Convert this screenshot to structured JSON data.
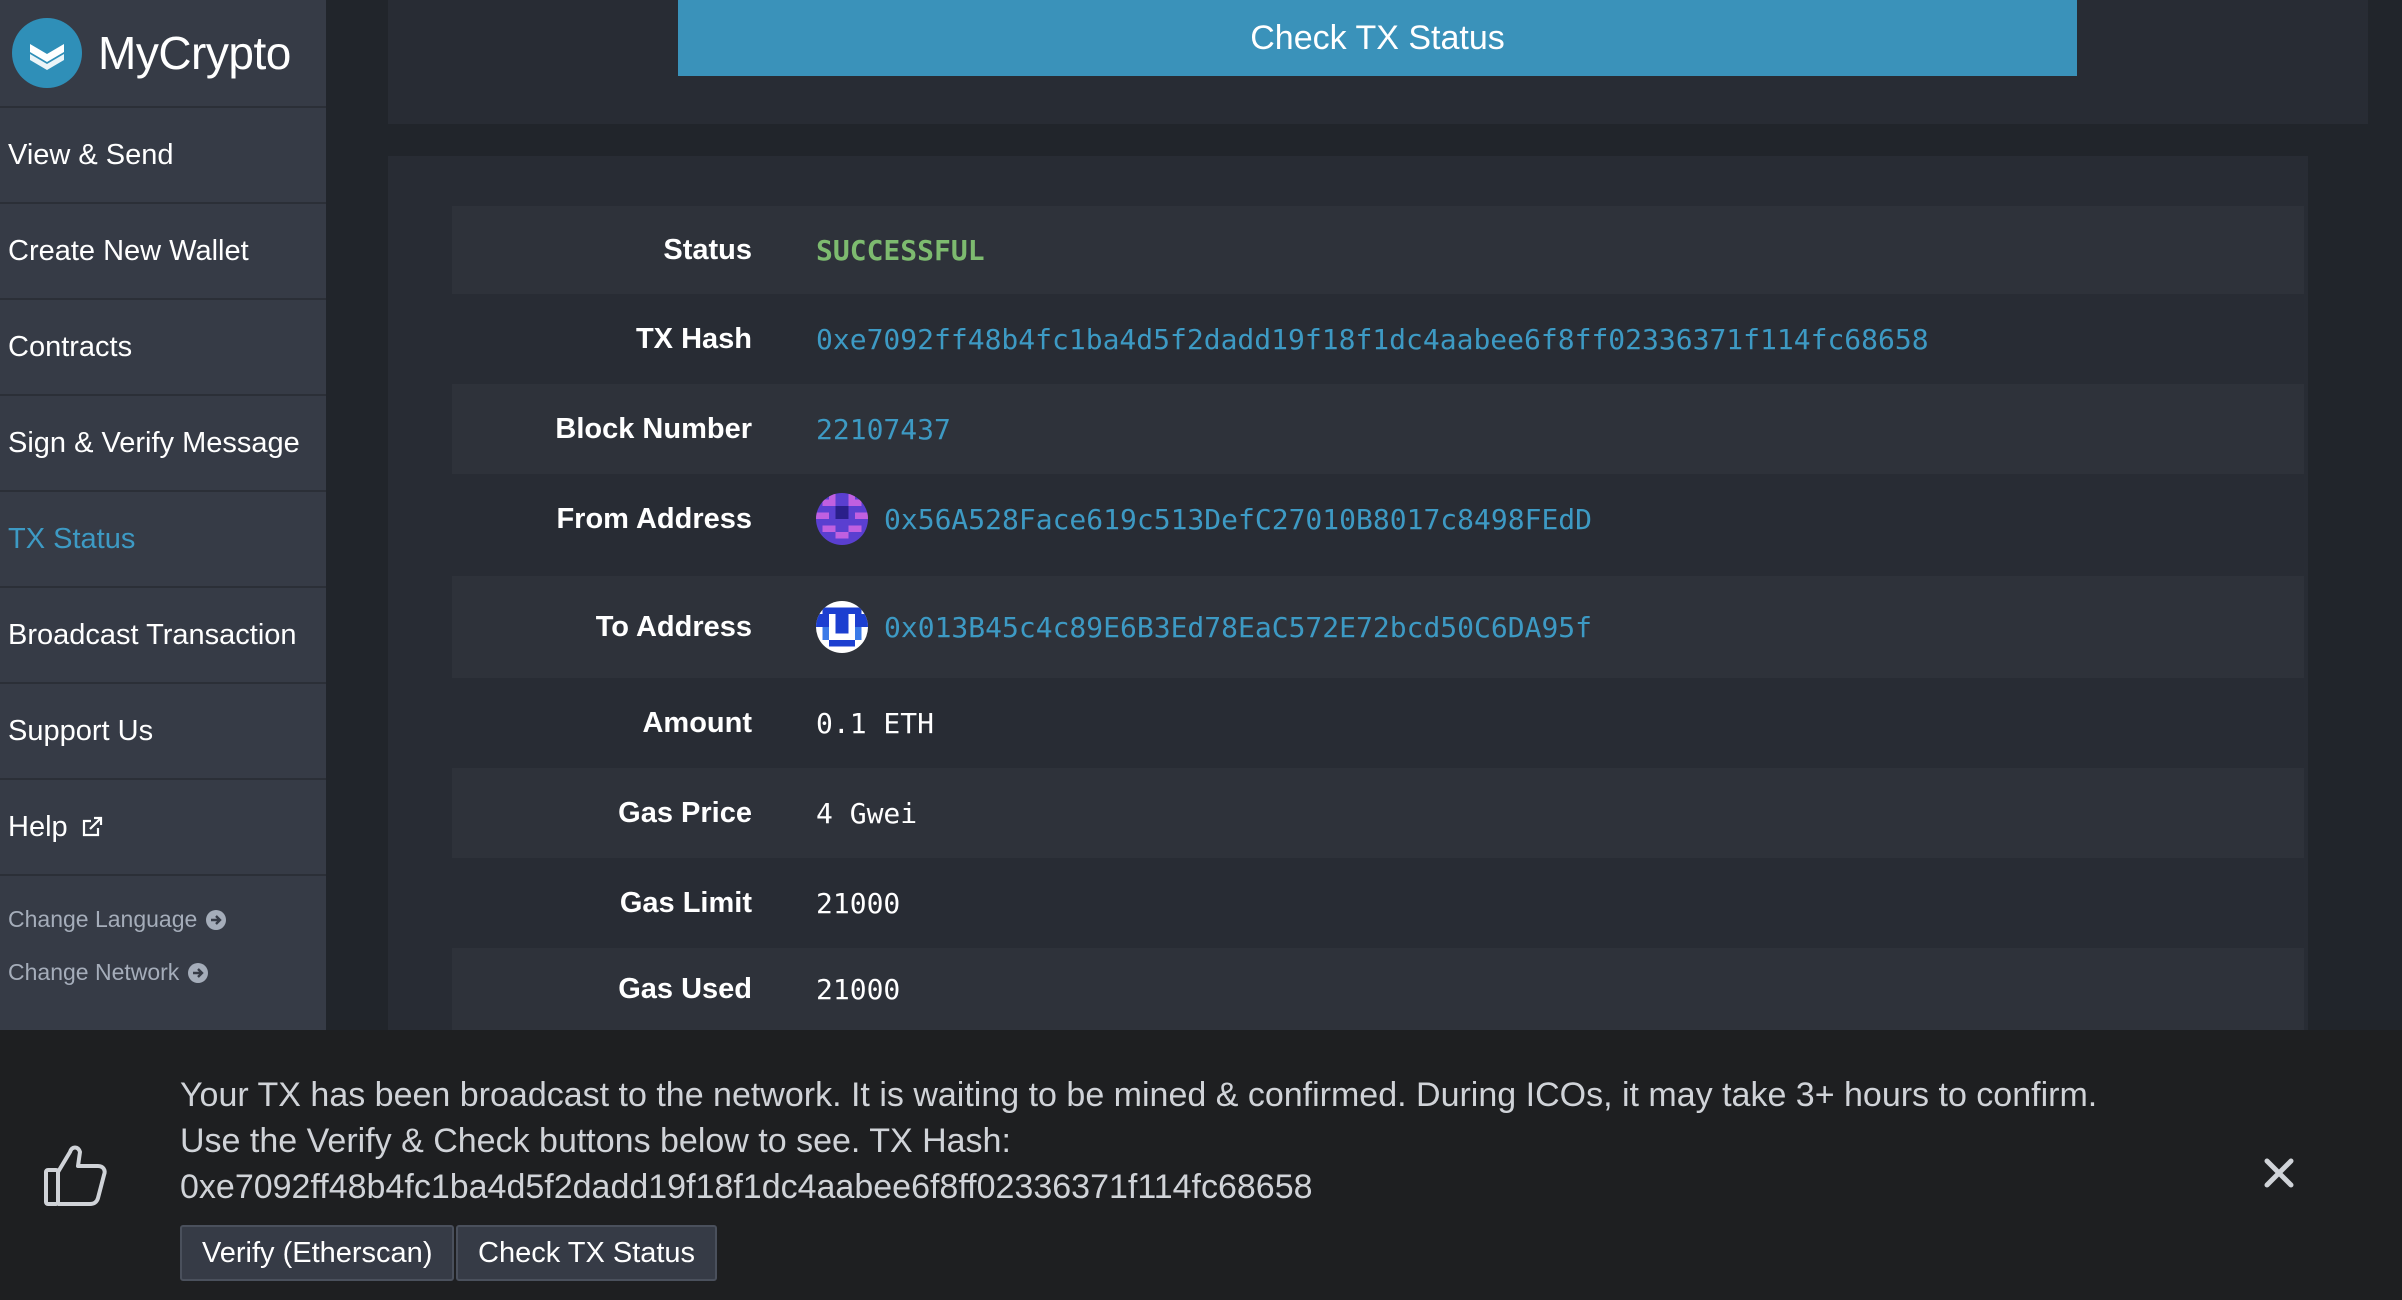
{
  "brand": {
    "name": "MyCrypto"
  },
  "sidebar": {
    "items": [
      {
        "label": "View & Send"
      },
      {
        "label": "Create New Wallet"
      },
      {
        "label": "Contracts"
      },
      {
        "label": "Sign & Verify Message"
      },
      {
        "label": "TX Status"
      },
      {
        "label": "Broadcast Transaction"
      },
      {
        "label": "Support Us"
      },
      {
        "label": "Help"
      }
    ],
    "active_item": "TX Status",
    "change_language": "Change Language",
    "change_network": "Change Network"
  },
  "main": {
    "check_button": "Check TX Status",
    "details": {
      "status": {
        "label": "Status",
        "value": "SUCCESSFUL"
      },
      "tx_hash": {
        "label": "TX Hash",
        "value": "0xe7092ff48b4fc1ba4d5f2dadd19f18f1dc4aabee6f8ff02336371f114fc68658"
      },
      "block_number": {
        "label": "Block Number",
        "value": "22107437"
      },
      "from_address": {
        "label": "From Address",
        "value": "0x56A528Face619c513DefC27010B8017c8498FEdD"
      },
      "to_address": {
        "label": "To Address",
        "value": "0x013B45c4c89E6B3Ed78EaC572E72bcd50C6DA95f"
      },
      "amount": {
        "label": "Amount",
        "value": "0.1 ETH"
      },
      "gas_price": {
        "label": "Gas Price",
        "value": "4 Gwei"
      },
      "gas_limit": {
        "label": "Gas Limit",
        "value": "21000"
      },
      "gas_used": {
        "label": "Gas Used",
        "value": "21000"
      }
    }
  },
  "notification": {
    "message": "Your TX has been broadcast to the network. It is waiting to be mined & confirmed. During ICOs, it may take 3+ hours to confirm. Use the Verify & Check buttons below to see. TX Hash: 0xe7092ff48b4fc1ba4d5f2dadd19f18f1dc4aabee6f8ff02336371f114fc68658",
    "verify_button": "Verify (Etherscan)",
    "check_button": "Check TX Status"
  },
  "colors": {
    "accent": "#3a92ba",
    "link": "#3d9ac4",
    "success": "#7dbb6f",
    "sidebar_bg": "#363b46",
    "panel_bg": "#282c34"
  },
  "icons": [
    "mycrypto-logo-icon",
    "external-link-icon",
    "arrow-circle-right-icon",
    "thumbs-up-icon",
    "close-icon",
    "identicon"
  ]
}
